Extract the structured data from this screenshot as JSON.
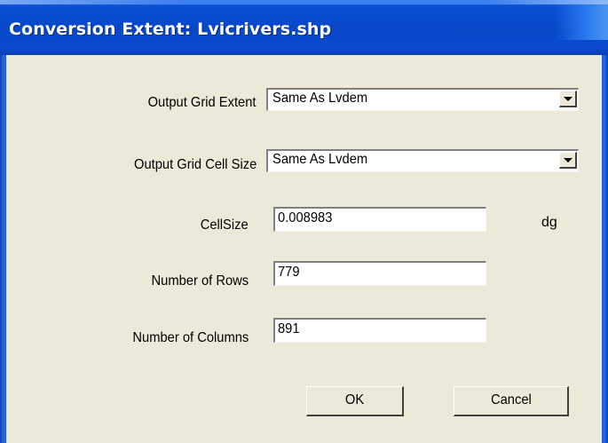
{
  "window": {
    "title": "Conversion Extent: Lvicrivers.shp"
  },
  "form": {
    "output_grid_extent": {
      "label": "Output Grid Extent",
      "value": "Same As Lvdem"
    },
    "output_grid_cell_size": {
      "label": "Output Grid Cell Size",
      "value": "Same As Lvdem"
    },
    "cell_size": {
      "label": "CellSize",
      "value": "0.008983",
      "unit": "dg"
    },
    "rows": {
      "label": "Number of Rows",
      "value": "779"
    },
    "columns": {
      "label": "Number of Columns",
      "value": "891"
    }
  },
  "buttons": {
    "ok": "OK",
    "cancel": "Cancel"
  },
  "icons": {
    "dropdown": "chevron-down-icon"
  },
  "colors": {
    "titlebar": "#0747c8",
    "dialog_bg": "#ece9d8"
  }
}
